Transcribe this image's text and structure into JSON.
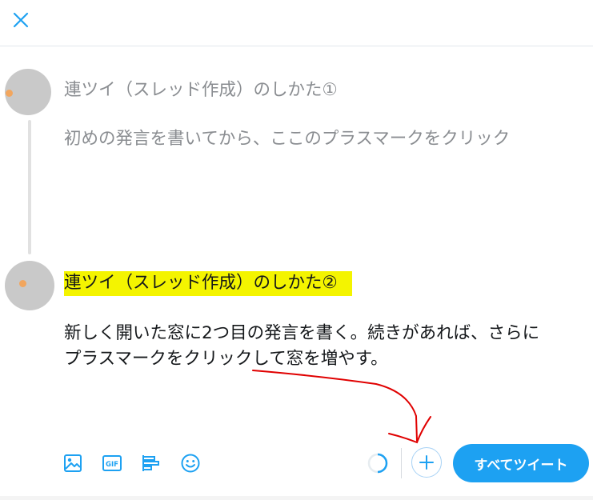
{
  "header": {
    "close_icon": "close-icon"
  },
  "thread": {
    "tweets": [
      {
        "title": "連ツイ（スレッド作成）のしかた①",
        "body": "初めの発言を書いてから、ここのプラスマークをクリック"
      },
      {
        "title": "連ツイ（スレッド作成）のしかた②",
        "body_line1": "新しく開いた窓に2つ目の発言を書く。続きがあれば、さらに",
        "body_line2": "プラスマークをクリックして窓を増やす。"
      }
    ]
  },
  "toolbar": {
    "icons": [
      "image-icon",
      "gif-icon",
      "poll-icon",
      "emoji-icon"
    ],
    "gif_label": "GIF",
    "tweet_all_label": "すべてツイート"
  },
  "colors": {
    "accent": "#1da1f2",
    "highlight": "#f4f400",
    "annotation": "#e00000"
  }
}
